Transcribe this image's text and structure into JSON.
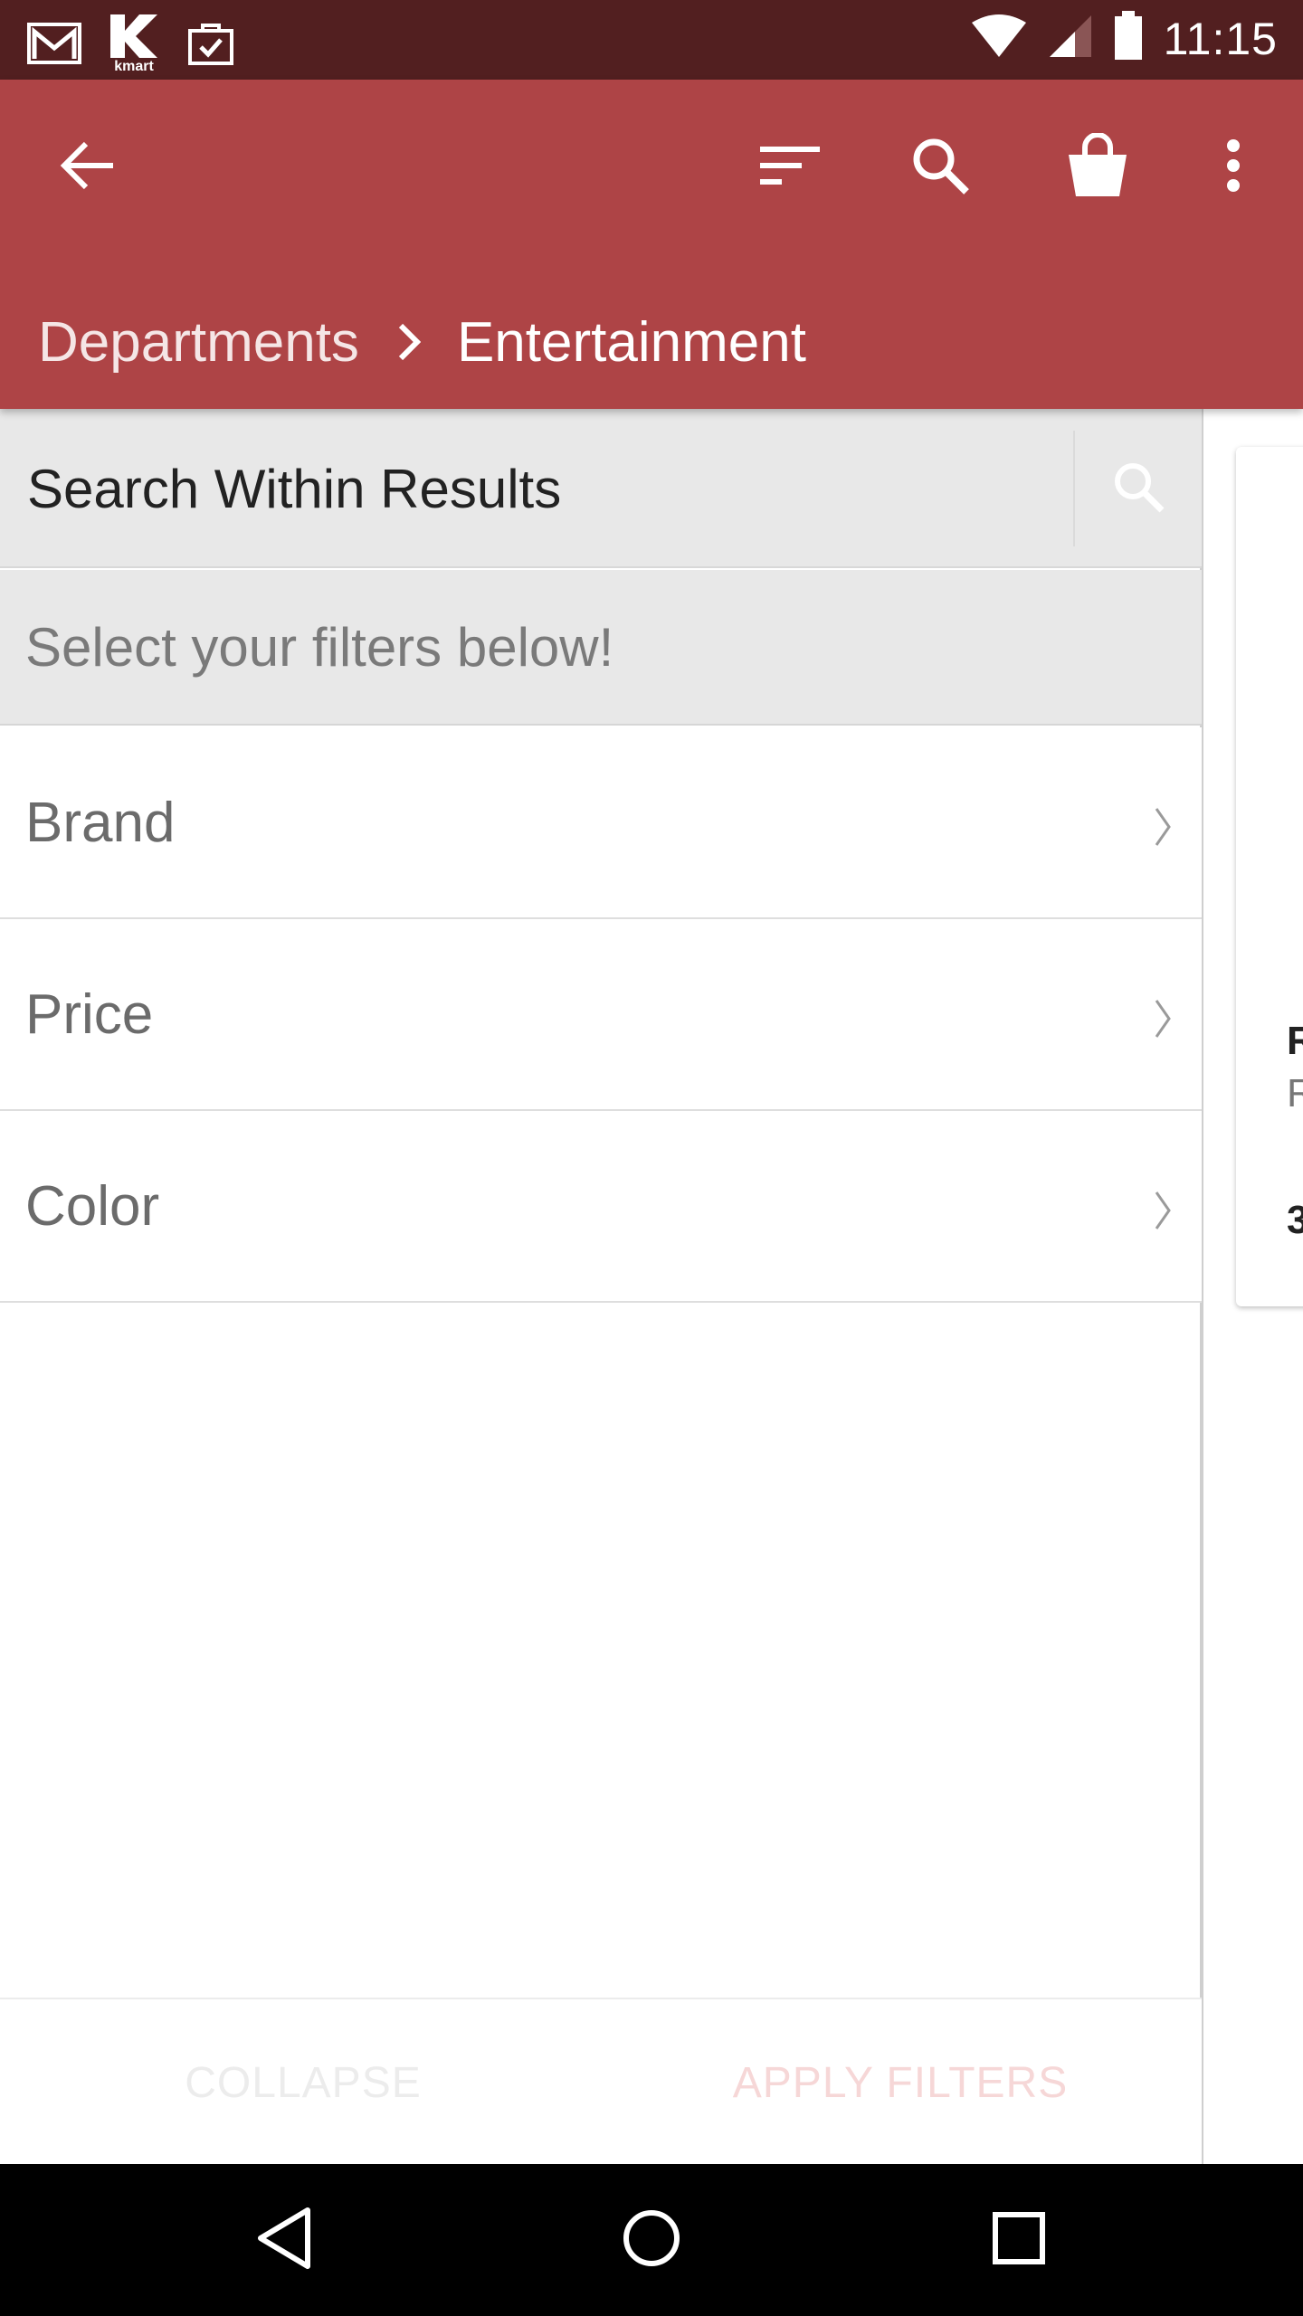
{
  "status_bar": {
    "time": "11:15",
    "notification_icons": [
      "gmail-icon",
      "kmart-icon",
      "bag-check-icon"
    ],
    "kmart_icon_text": "kmart"
  },
  "app_bar": {
    "background_color": "#ae4446",
    "icons": [
      "back-arrow-icon",
      "sort-icon",
      "search-icon",
      "shopping-bag-icon",
      "more-vert-icon"
    ]
  },
  "breadcrumb": {
    "parent": "Departments",
    "current": "Entertainment"
  },
  "filter_panel": {
    "search_placeholder": "Search Within Results",
    "hint": "Select your filters below!",
    "filters": [
      {
        "label": "Brand"
      },
      {
        "label": "Price"
      },
      {
        "label": "Color"
      }
    ],
    "collapse_label": "COLLAPSE",
    "apply_label": "APPLY FILTERS"
  },
  "background_card": {
    "title_fragment": "R",
    "subtitle_fragment": "R",
    "price_fragment": "3"
  },
  "nav_bar": {
    "icons": [
      "back-triangle-icon",
      "home-circle-icon",
      "recents-square-icon"
    ]
  }
}
